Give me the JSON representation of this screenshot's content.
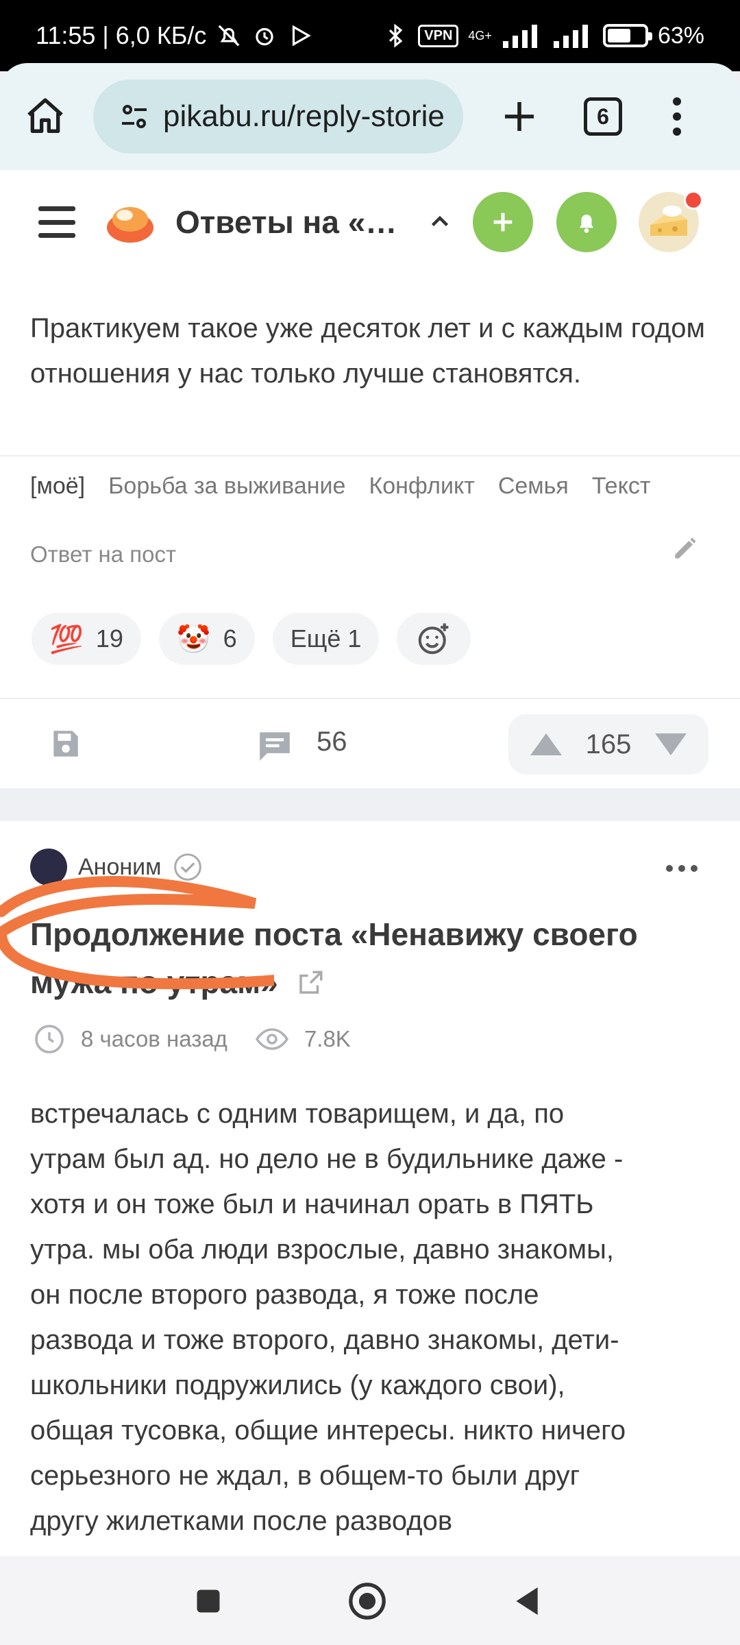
{
  "status_bar": {
    "time_speed": "11:55 | 6,0 КБ/с",
    "network": "4G+",
    "vpn": "VPN",
    "battery_percent": "63%",
    "battery_level": 0.63
  },
  "browser": {
    "url": "pikabu.ru/reply-storie",
    "tab_count": "6"
  },
  "site_header": {
    "title": "Ответы на «Ненавижу своего мужа по утрам»"
  },
  "post1": {
    "text": "Практикуем такое уже десяток лет и с каждым годом отношения у нас только лучше становятся.",
    "tags": [
      "[моё]",
      "Борьба за выживание",
      "Конфликт",
      "Семья",
      "Текст"
    ],
    "reply_to": "Ответ на пост",
    "reactions": [
      {
        "emoji": "💯",
        "count": "19"
      },
      {
        "emoji": "🤡",
        "count": "6"
      }
    ],
    "more_reactions": "Ещё 1",
    "comments": "56",
    "rating": "165"
  },
  "post2": {
    "author": "Аноним",
    "title": "Продолжение поста «Ненавижу своего мужа по утрам»",
    "time": "8 часов назад",
    "views": "7.8K",
    "body_lines": [
      "встречалась с одним товарищем, и да, по",
      "утрам был ад. но дело не в будильнике даже -",
      "хотя и он тоже был и начинал орать в ПЯТЬ",
      "утра. мы оба люди взрослые, давно знакомы,",
      "он после второго развода, я тоже после",
      "развода и тоже второго, давно знакомы, дети-",
      "школьники подружились (у каждого свои),",
      "общая тусовка, общие интересы. никто ничего",
      "серьезного не ждал, в общем-то были друг",
      "другу жилетками после разводов"
    ]
  },
  "colors": {
    "accent_green": "#8ac858",
    "scribble": "#f07840",
    "url_bg": "#d0e6e9"
  }
}
